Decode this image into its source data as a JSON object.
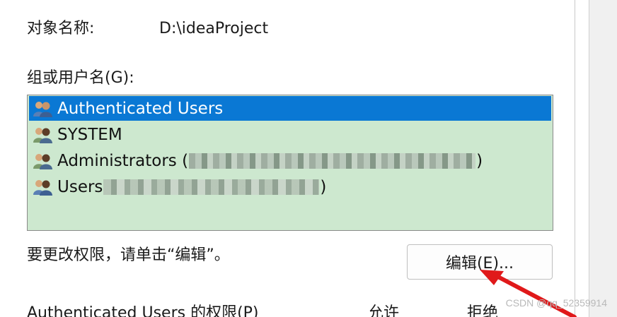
{
  "object_name_label": "对象名称:",
  "object_name_value": "D:\\ideaProject",
  "group_label": "组或用户名(G):",
  "users": [
    {
      "name": "Authenticated Users",
      "selected": true,
      "icon": "user-group-icon"
    },
    {
      "name": "SYSTEM",
      "selected": false,
      "icon": "user-group-icon"
    },
    {
      "name": "Administrators (",
      "suffix": ")",
      "selected": false,
      "icon": "user-group-icon"
    },
    {
      "name": "Users ",
      "suffix": ")",
      "selected": false,
      "icon": "user-group-icon"
    }
  ],
  "hint_text": "要更改权限，请单击“编辑”。",
  "edit_button_label": "编辑(E)...",
  "permissions_header": {
    "label": "Authenticated Users 的权限(P)",
    "allow": "允许",
    "deny": "拒绝"
  },
  "watermark": "CSDN @qq_52359914",
  "colors": {
    "selection": "#0a78d4",
    "list_background": "#cde8cf",
    "annotation_arrow": "#e0191a"
  }
}
